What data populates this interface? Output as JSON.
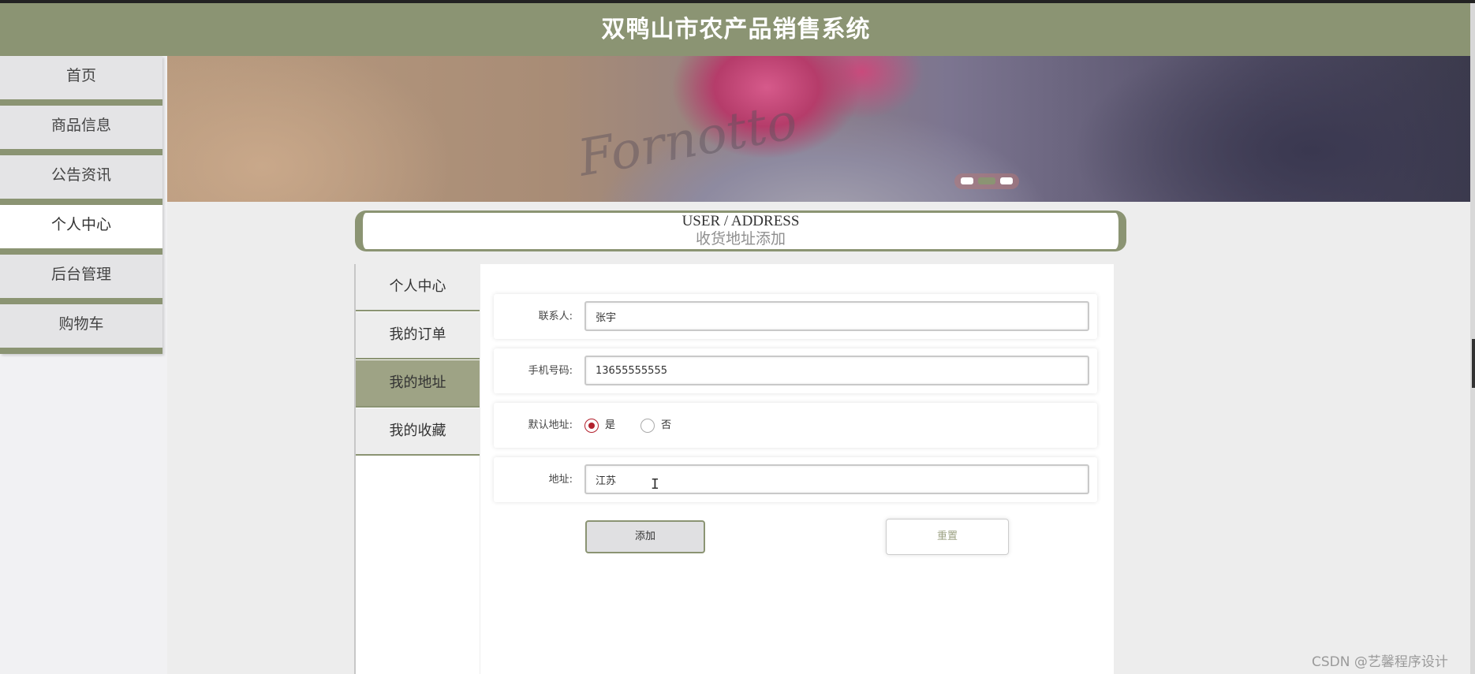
{
  "app": {
    "title": "双鸭山市农产品销售系统"
  },
  "sidebar": {
    "items": [
      {
        "label": "首页",
        "active": false
      },
      {
        "label": "商品信息",
        "active": false
      },
      {
        "label": "公告资讯",
        "active": false
      },
      {
        "label": "个人中心",
        "active": true
      },
      {
        "label": "后台管理",
        "active": false
      },
      {
        "label": "购物车",
        "active": false
      }
    ]
  },
  "banner": {
    "image_text": "Fornotto",
    "slide_count": 3,
    "active_slide": 2
  },
  "page": {
    "title_en": "USER / ADDRESS",
    "title_cn": "收货地址添加"
  },
  "user_nav": {
    "items": [
      {
        "label": "个人中心",
        "active": false
      },
      {
        "label": "我的订单",
        "active": false
      },
      {
        "label": "我的地址",
        "active": true
      },
      {
        "label": "我的收藏",
        "active": false
      }
    ]
  },
  "form": {
    "contact": {
      "label": "联系人:",
      "value": "张宇"
    },
    "phone": {
      "label": "手机号码:",
      "value": "13655555555"
    },
    "default_address": {
      "label": "默认地址:",
      "options": [
        "是",
        "否"
      ],
      "selected": "是"
    },
    "address": {
      "label": "地址:",
      "value": "江苏"
    },
    "add_label": "添加",
    "reset_label": "重置"
  },
  "colors": {
    "accent": "#8b9473",
    "radio_checked": "#b3212d"
  },
  "watermark": "CSDN @艺馨程序设计"
}
